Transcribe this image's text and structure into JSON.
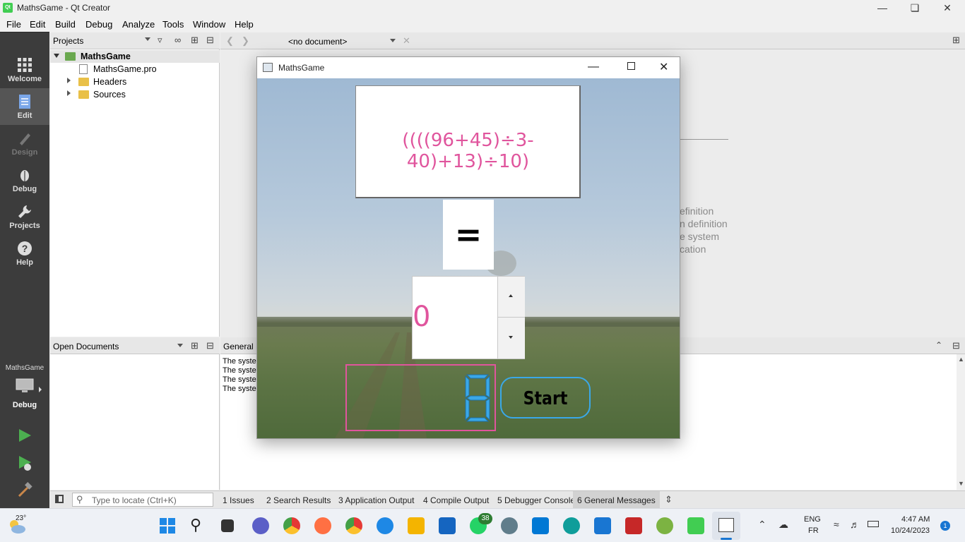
{
  "window": {
    "title": "MathsGame - Qt Creator"
  },
  "menu": [
    "File",
    "Edit",
    "Build",
    "Debug",
    "Analyze",
    "Tools",
    "Window",
    "Help"
  ],
  "modes": [
    {
      "label": "Welcome",
      "icon": "grid-icon"
    },
    {
      "label": "Edit",
      "icon": "document-icon"
    },
    {
      "label": "Design",
      "icon": "pencil-icon"
    },
    {
      "label": "Debug",
      "icon": "bug-icon"
    },
    {
      "label": "Projects",
      "icon": "wrench-icon"
    },
    {
      "label": "Help",
      "icon": "help-icon"
    }
  ],
  "kit": {
    "project": "MathsGame",
    "mode": "Debug"
  },
  "projects_pane": {
    "title": "Projects"
  },
  "editor": {
    "document": "<no document>"
  },
  "tree": [
    {
      "label": "MathsGame"
    },
    {
      "label": "MathsGame.pro"
    },
    {
      "label": "Headers"
    },
    {
      "label": "Sources"
    }
  ],
  "open_documents": {
    "title": "Open Documents"
  },
  "general_messages": {
    "title": "General M",
    "lines": [
      "The syste",
      "The syste",
      "The syste",
      "The syste"
    ]
  },
  "editor_hints": [
    "efinition",
    "n definition",
    "e system",
    "cation"
  ],
  "locator": {
    "placeholder": "Type to locate (Ctrl+K)"
  },
  "output_tabs": [
    "1  Issues",
    "2  Search Results",
    "3  Application Output",
    "4  Compile Output",
    "5  Debugger Console",
    "6  General Messages"
  ],
  "app": {
    "title": "MathsGame",
    "expression": "((((96+45)÷3-40)+13)÷10)",
    "equals": "=",
    "answer": "0",
    "start_label": "Start"
  },
  "taskbar": {
    "weather": "23°",
    "whatsapp_badge": "38",
    "lang": "ENG",
    "lang2": "FR",
    "time": "4:47 AM",
    "date": "10/24/2023",
    "notif": "1"
  },
  "colors": {
    "accent_pink": "#e0559d",
    "lcd_blue": "#3aa8e8",
    "mode_bg": "#3c3c3c"
  }
}
